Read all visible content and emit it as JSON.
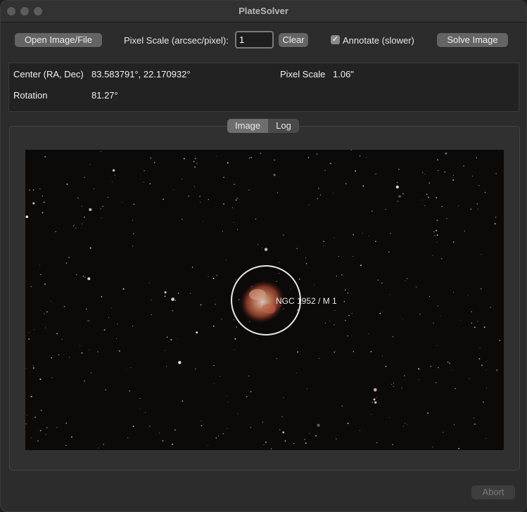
{
  "window": {
    "title": "PlateSolver"
  },
  "toolbar": {
    "open_label": "Open Image/File",
    "pixel_scale_label": "Pixel Scale (arcsec/pixel):",
    "pixel_scale_value": "1",
    "clear_label": "Clear",
    "annotate_label": "Annotate (slower)",
    "annotate_checked": true,
    "solve_label": "Solve Image"
  },
  "results": {
    "center_label": "Center (RA, Dec)",
    "center_value": "83.583791°, 22.170932°",
    "pixel_scale_label": "Pixel Scale",
    "pixel_scale_value": "1.06\"",
    "rotation_label": "Rotation",
    "rotation_value": "81.27°"
  },
  "tabs": [
    {
      "label": "Image",
      "active": true
    },
    {
      "label": "Log",
      "active": false
    }
  ],
  "image": {
    "annotation_label": "NGC 1952 / M 1"
  },
  "footer": {
    "abort_label": "Abort"
  }
}
